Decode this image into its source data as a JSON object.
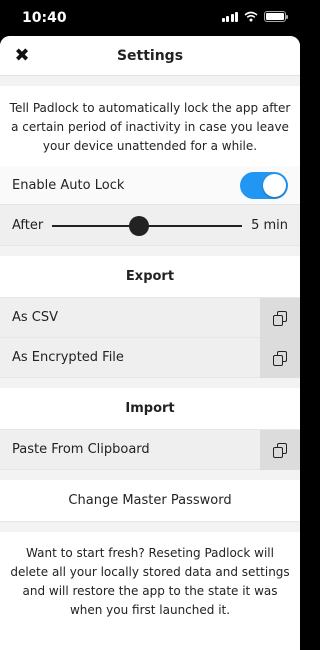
{
  "status_bar": {
    "time": "10:40",
    "icons": [
      "signal-icon",
      "wifi-icon",
      "battery-icon"
    ]
  },
  "nav": {
    "close_icon": "close-icon",
    "close_glyph": "✖",
    "title": "Settings"
  },
  "auto_lock": {
    "description": "Tell Padlock to automatically lock the app after a certain period of inactivity in case you leave your device unattended for a while.",
    "toggle_label": "Enable Auto Lock",
    "toggle_on": true,
    "slider_label": "After",
    "slider_value": "5 min",
    "slider_fraction": 0.46
  },
  "export": {
    "header": "Export",
    "items": [
      {
        "label": "As CSV",
        "icon": "copy-icon"
      },
      {
        "label": "As Encrypted File",
        "icon": "copy-icon"
      }
    ]
  },
  "import": {
    "header": "Import",
    "items": [
      {
        "label": "Paste From Clipboard",
        "icon": "copy-icon"
      }
    ]
  },
  "change_password": {
    "label": "Change Master Password"
  },
  "reset": {
    "description": "Want to start fresh? Reseting Padlock will delete all your locally stored data and settings and will restore the app to the state it was when you first launched it."
  },
  "colors": {
    "accent": "#2196f3",
    "row_bg": "#efefef",
    "icon_bg": "#dcdcdc"
  }
}
